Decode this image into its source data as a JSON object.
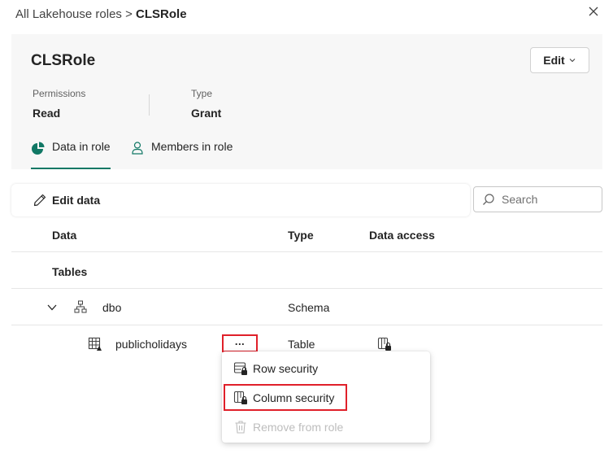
{
  "breadcrumb": {
    "parent": "All Lakehouse roles",
    "separator": ">",
    "current": "CLSRole"
  },
  "role": {
    "title": "CLSRole",
    "edit_label": "Edit",
    "permissions_label": "Permissions",
    "permissions_value": "Read",
    "type_label": "Type",
    "type_value": "Grant"
  },
  "tabs": [
    {
      "label": "Data in role",
      "icon": "pie-chart-icon",
      "active": true
    },
    {
      "label": "Members in role",
      "icon": "person-icon",
      "active": false
    }
  ],
  "toolbar": {
    "edit_data_label": "Edit data",
    "search_placeholder": "Search"
  },
  "table": {
    "columns": [
      "Data",
      "Type",
      "Data access"
    ],
    "section": "Tables",
    "rows": [
      {
        "name": "dbo",
        "type": "Schema",
        "icon": "schema-icon",
        "expanded": true
      },
      {
        "name": "publicholidays",
        "type": "Table",
        "icon": "table-icon",
        "more": "...",
        "access_icon": "column-lock-icon"
      }
    ]
  },
  "context_menu": {
    "items": [
      {
        "label": "Row security",
        "icon": "row-security-icon",
        "disabled": false
      },
      {
        "label": "Column security",
        "icon": "column-security-icon",
        "disabled": false,
        "highlighted": true
      },
      {
        "label": "Remove from role",
        "icon": "trash-icon",
        "disabled": true
      }
    ]
  },
  "colors": {
    "accent": "#117865",
    "highlight": "#e0202a",
    "header_bg": "#f7f7f7"
  }
}
